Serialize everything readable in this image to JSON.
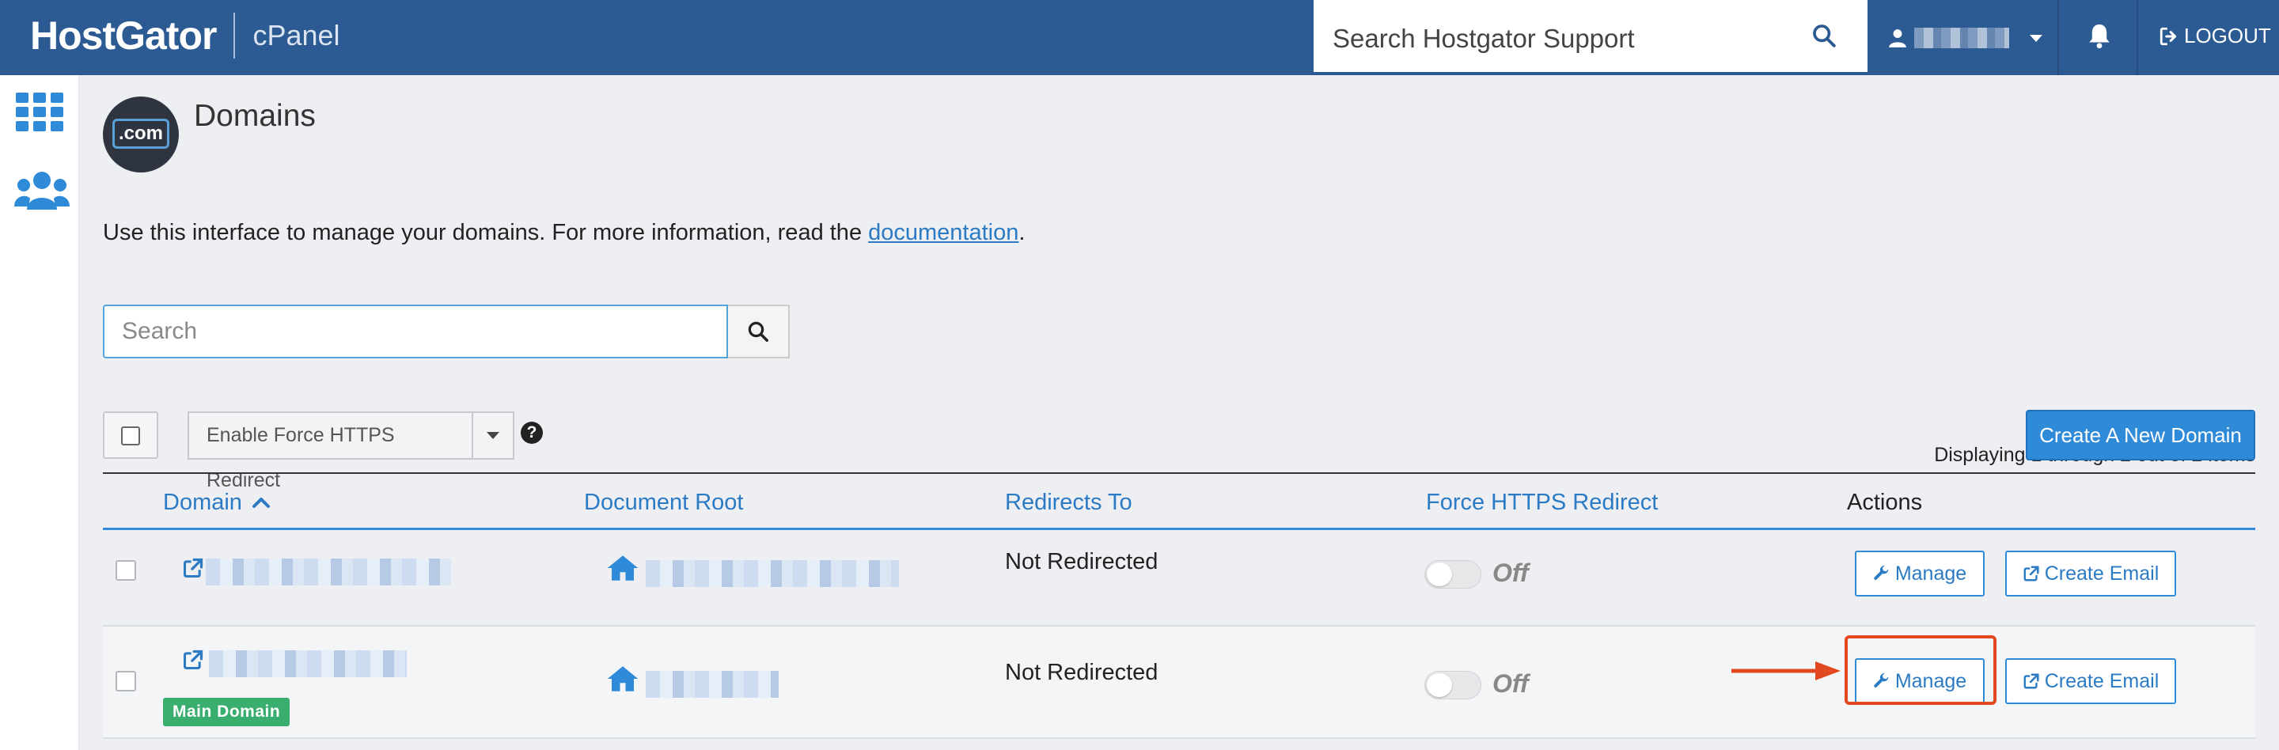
{
  "header": {
    "brand": "HostGator",
    "product": "cPanel",
    "support_search_placeholder": "Search Hostgator Support",
    "logout_label": "LOGOUT"
  },
  "page": {
    "icon_text": ".com",
    "title": "Domains",
    "intro_text": "Use this interface to manage your domains. For more information, read the ",
    "intro_link": "documentation",
    "intro_end": "."
  },
  "toolbar": {
    "search_placeholder": "Search",
    "displaying": "Displaying 1 through 2 out of 2 items",
    "bulk_action": "Enable Force HTTPS Redirect",
    "help": "?",
    "create_label": "Create A New Domain"
  },
  "table": {
    "headers": {
      "domain": "Domain",
      "docroot": "Document Root",
      "redirects": "Redirects To",
      "https": "Force HTTPS Redirect",
      "actions": "Actions"
    },
    "rows": [
      {
        "redirects": "Not Redirected",
        "https_state": "Off",
        "manage": "Manage",
        "create_email": "Create Email",
        "badge": ""
      },
      {
        "redirects": "Not Redirected",
        "https_state": "Off",
        "manage": "Manage",
        "create_email": "Create Email",
        "badge": "Main Domain"
      }
    ]
  },
  "colors": {
    "header_bg": "#2c5a93",
    "link": "#2b7ac4",
    "primary_button": "#2f8ad8",
    "badge": "#3aae6e",
    "callout": "#e2481f"
  }
}
